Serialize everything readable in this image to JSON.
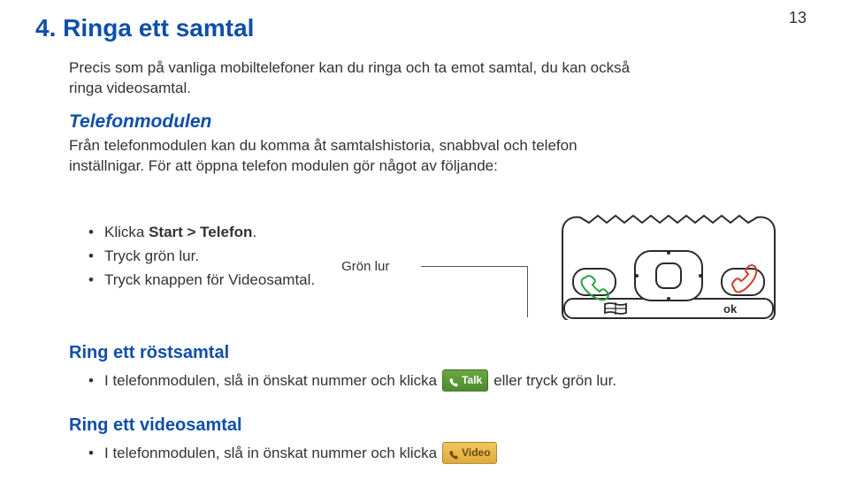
{
  "page_number": "13",
  "section_number": "4.",
  "section_title": "Ringa ett samtal",
  "intro_text": "Precis som på vanliga mobiltelefoner kan du ringa och ta emot samtal, du kan också ringa videosamtal.",
  "telefonmodulen": {
    "heading": "Telefonmodulen",
    "body": "Från telefonmodulen kan du komma åt samtalshistoria, snabbval och telefon inställnigar. För att öppna telefon modulen gör något av följande:"
  },
  "bullets1": {
    "item1_prefix": "Klicka ",
    "item1_bold": "Start > Telefon",
    "item1_suffix": ".",
    "item2": "Tryck grön lur.",
    "item3": "Tryck knappen för Videosamtal."
  },
  "gron_lur_label": "Grön lur",
  "keypad": {
    "windows_label": "windows-icon",
    "ok_label": "ok"
  },
  "rostsamtal": {
    "heading": "Ring ett röstsamtal",
    "bullet_prefix": "I telefonmodulen, slå in önskat nummer och klicka ",
    "bullet_button": "Talk",
    "bullet_suffix": " eller tryck grön lur."
  },
  "videosamtal": {
    "heading": "Ring ett videosamtal",
    "bullet_prefix": "I telefonmodulen, slå in önskat nummer och klicka ",
    "bullet_button": "Video"
  }
}
